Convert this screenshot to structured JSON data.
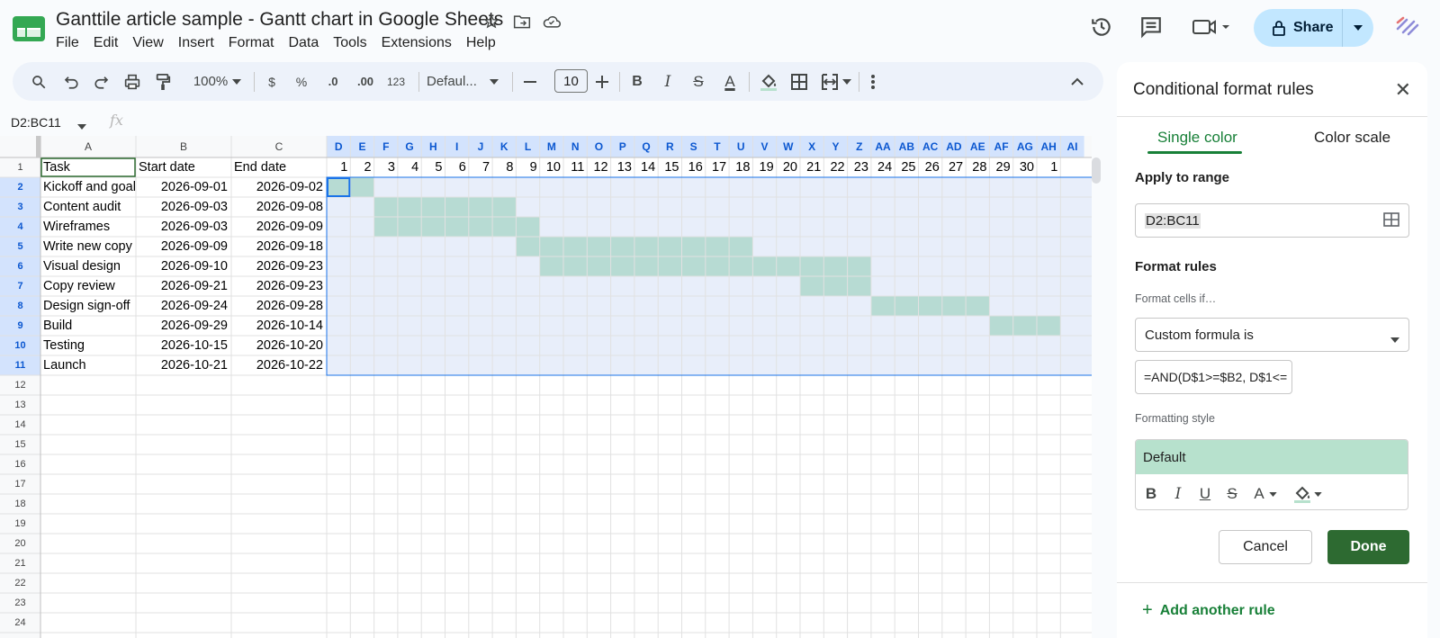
{
  "document": {
    "title": "Ganttile article sample - Gantt chart in Google Sheets"
  },
  "menu": [
    "File",
    "Edit",
    "View",
    "Insert",
    "Format",
    "Data",
    "Tools",
    "Extensions",
    "Help"
  ],
  "header": {
    "share_label": "Share"
  },
  "toolbar": {
    "zoom": "100%",
    "currency": "$",
    "percent": "%",
    "dec_decrease": ".0",
    "dec_increase": ".00",
    "number_format": "123",
    "font": "Defaul...",
    "font_size": "10",
    "bold": "B",
    "italic": "I",
    "strike": "S",
    "text_color": "A"
  },
  "formula_bar": {
    "name_box": "D2:BC11",
    "fx": "fx"
  },
  "sheet": {
    "col_letters": [
      "A",
      "B",
      "C",
      "D",
      "E",
      "F",
      "G",
      "H",
      "I",
      "J",
      "K",
      "L",
      "M",
      "N",
      "O",
      "P",
      "Q",
      "R",
      "S",
      "T",
      "U",
      "V",
      "W",
      "X",
      "Y",
      "Z",
      "AA",
      "AB",
      "AC",
      "AD",
      "AE",
      "AF",
      "AG",
      "AH",
      "AI"
    ],
    "row_numbers": [
      "1",
      "2",
      "3",
      "4",
      "5",
      "6",
      "7",
      "8",
      "9",
      "10",
      "11",
      "12",
      "13",
      "14",
      "15",
      "16",
      "17",
      "18",
      "19",
      "20",
      "21",
      "22",
      "23",
      "24"
    ],
    "headers": [
      "Task",
      "Start date",
      "End date"
    ],
    "day_numbers": [
      "1",
      "2",
      "3",
      "4",
      "5",
      "6",
      "7",
      "8",
      "9",
      "10",
      "11",
      "12",
      "13",
      "14",
      "15",
      "16",
      "17",
      "18",
      "19",
      "20",
      "21",
      "22",
      "23",
      "24",
      "25",
      "26",
      "27",
      "28",
      "29",
      "30",
      "1"
    ],
    "tasks": [
      {
        "task": "Kickoff and goals",
        "start": "2026-09-01",
        "end": "2026-09-02",
        "bar": [
          1,
          2
        ]
      },
      {
        "task": "Content audit",
        "start": "2026-09-03",
        "end": "2026-09-08",
        "bar": [
          3,
          8
        ]
      },
      {
        "task": "Wireframes",
        "start": "2026-09-03",
        "end": "2026-09-09",
        "bar": [
          3,
          9
        ]
      },
      {
        "task": "Write new copy",
        "start": "2026-09-09",
        "end": "2026-09-18",
        "bar": [
          9,
          18
        ]
      },
      {
        "task": "Visual design",
        "start": "2026-09-10",
        "end": "2026-09-23",
        "bar": [
          10,
          23
        ]
      },
      {
        "task": "Copy review",
        "start": "2026-09-21",
        "end": "2026-09-23",
        "bar": [
          21,
          23
        ]
      },
      {
        "task": "Design sign-off",
        "start": "2026-09-24",
        "end": "2026-09-28",
        "bar": [
          24,
          28
        ]
      },
      {
        "task": "Build",
        "start": "2026-09-29",
        "end": "2026-10-14",
        "bar": [
          29,
          31
        ]
      },
      {
        "task": "Testing",
        "start": "2026-10-15",
        "end": "2026-10-20",
        "bar": null
      },
      {
        "task": "Launch",
        "start": "2026-10-21",
        "end": "2026-10-22",
        "bar": null
      }
    ],
    "colors": {
      "bar": "#b7dbd3",
      "selection": "#e8eefa",
      "header_selected": "#d3e3fd",
      "selection_border": "#1a73e8"
    }
  },
  "panel": {
    "title": "Conditional format rules",
    "tab_single": "Single color",
    "tab_scale": "Color scale",
    "apply_label": "Apply to range",
    "range_value": "D2:BC11",
    "rules_label": "Format rules",
    "cells_if_label": "Format cells if…",
    "condition": "Custom formula is",
    "formula": "=AND(D$1>=$B2, D$1<=",
    "style_label": "Formatting style",
    "style_preview": "Default",
    "style_color": "#b7e1cd",
    "cancel_label": "Cancel",
    "done_label": "Done",
    "add_rule_label": "Add another rule"
  }
}
